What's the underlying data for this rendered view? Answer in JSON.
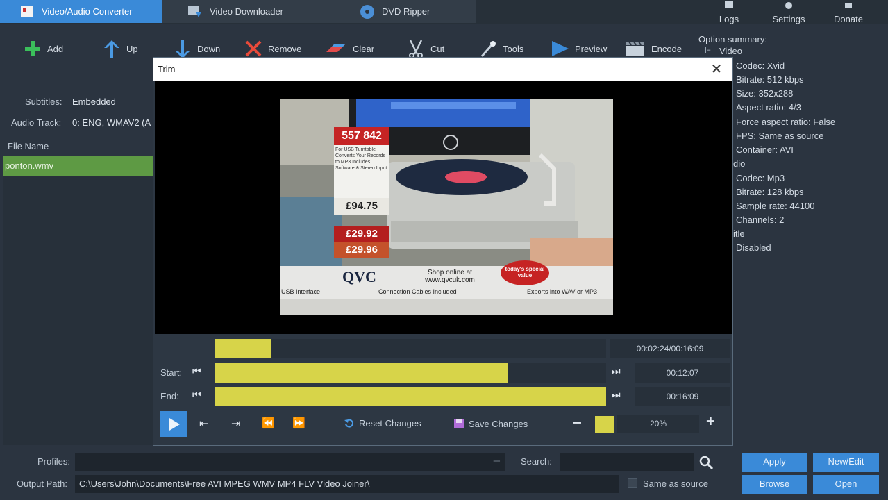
{
  "tabs": [
    {
      "label": "Video/Audio Converter",
      "active": true
    },
    {
      "label": "Video Downloader",
      "active": false
    },
    {
      "label": "DVD Ripper",
      "active": false
    }
  ],
  "top_buttons": {
    "logs": "Logs",
    "settings": "Settings",
    "donate": "Donate"
  },
  "toolbar": {
    "add": "Add",
    "up": "Up",
    "down": "Down",
    "remove": "Remove",
    "clear": "Clear",
    "cut": "Cut",
    "tools": "Tools",
    "preview": "Preview",
    "encode": "Encode"
  },
  "left": {
    "subtitles_label": "Subtitles:",
    "subtitles_value": "Embedded",
    "audio_track_label": "Audio Track:",
    "audio_track_value": "0: ENG, WMAV2 (A",
    "file_name_header": "File Name",
    "file_row": "ponton.wmv"
  },
  "summary": {
    "title": "Option summary:",
    "lines": [
      "Video",
      "Codec: Xvid",
      "Bitrate: 512 kbps",
      "Size: 352x288",
      "Aspect ratio: 4/3",
      "Force aspect ratio: False",
      "FPS: Same as source",
      "Container: AVI",
      "dio",
      "Codec: Mp3",
      "Bitrate: 128 kbps",
      "Sample rate: 44100",
      "Channels: 2",
      "itle",
      "Disabled"
    ]
  },
  "dialog": {
    "title": "Trim",
    "video_overlay": {
      "price_top": "557 842",
      "promo_text": "For USB Turntable Converts Your Records to MP3 Includes Software & Stereo Input",
      "was_price": "£94.75",
      "price1": "£29.92",
      "price2": "£29.96",
      "brand": "QVC",
      "shop_text": "Shop online at www.qvcuk.com",
      "badge": "today's special value",
      "ticker1": "USB Interface",
      "ticker2": "Connection Cables Included",
      "ticker3": "Exports into WAV or MP3"
    },
    "position_time": "00:02:24/00:16:09",
    "start_label": "Start:",
    "start_time": "00:12:07",
    "end_label": "End:",
    "end_time": "00:16:09",
    "position_fraction": 0.142,
    "start_fraction": 0.75,
    "end_fraction": 1.0,
    "reset_label": "Reset Changes",
    "save_label": "Save Changes",
    "zoom": "20%"
  },
  "bottom": {
    "profiles_label": "Profiles:",
    "profiles_value": "",
    "search_label": "Search:",
    "search_value": "",
    "output_label": "Output Path:",
    "output_value": "C:\\Users\\John\\Documents\\Free AVI MPEG WMV MP4 FLV Video Joiner\\",
    "same_as_source": "Same as source",
    "apply": "Apply",
    "new_edit": "New/Edit",
    "browse": "Browse",
    "open": "Open"
  },
  "colors": {
    "accent": "#3a8ad8",
    "timeline": "#d7d449",
    "selected_row": "#5e9a44",
    "background": "#2b3440"
  }
}
